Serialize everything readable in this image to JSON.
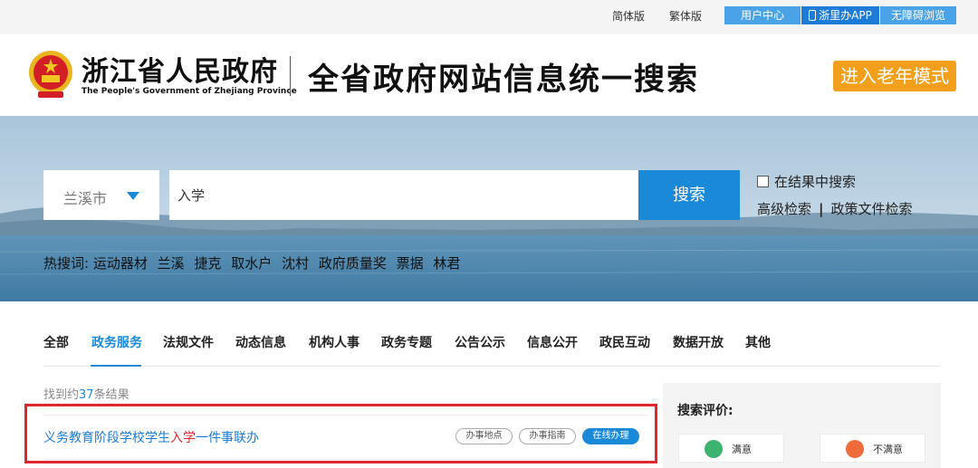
{
  "topbar": {
    "simplified": "简体版",
    "traditional": "繁体版",
    "user_center": "用户中心",
    "app": "浙里办APP",
    "accessible": "无障碍浏览"
  },
  "header": {
    "site_name": "浙江省人民政府",
    "site_name_en": "The People's Government of Zhejiang Province",
    "page_title": "全省政府网站信息统一搜索",
    "elder_mode": "进入老年模式"
  },
  "search": {
    "region": "兰溪市",
    "query": "入学",
    "button": "搜索",
    "in_result_label": "在结果中搜索",
    "advanced": "高级检索",
    "separator": "|",
    "policy": "政策文件检索"
  },
  "hot": {
    "label": "热搜词:",
    "keywords": [
      "运动器材",
      "兰溪",
      "捷克",
      "取水户",
      "沈村",
      "政府质量奖",
      "票据",
      "林君"
    ]
  },
  "tabs": [
    "全部",
    "政务服务",
    "法规文件",
    "动态信息",
    "机构人事",
    "政务专题",
    "公告公示",
    "信息公开",
    "政民互动",
    "数据开放",
    "其他"
  ],
  "results": {
    "count_prefix": "找到约",
    "count": "37",
    "count_suffix": "条结果",
    "items": [
      {
        "title_before": "义务教育阶段学校学生",
        "title_keyword": "入学",
        "title_after": "一件事联办",
        "actions": [
          "办事地点",
          "办事指南",
          "在线办理"
        ]
      }
    ]
  },
  "side": {
    "title": "搜索评价:",
    "satisfied": "满意",
    "unsatisfied": "不满意"
  },
  "colors": {
    "primary": "#1a8ad8",
    "accent_orange": "#f2a01c",
    "highlight_red": "#e0262e"
  }
}
